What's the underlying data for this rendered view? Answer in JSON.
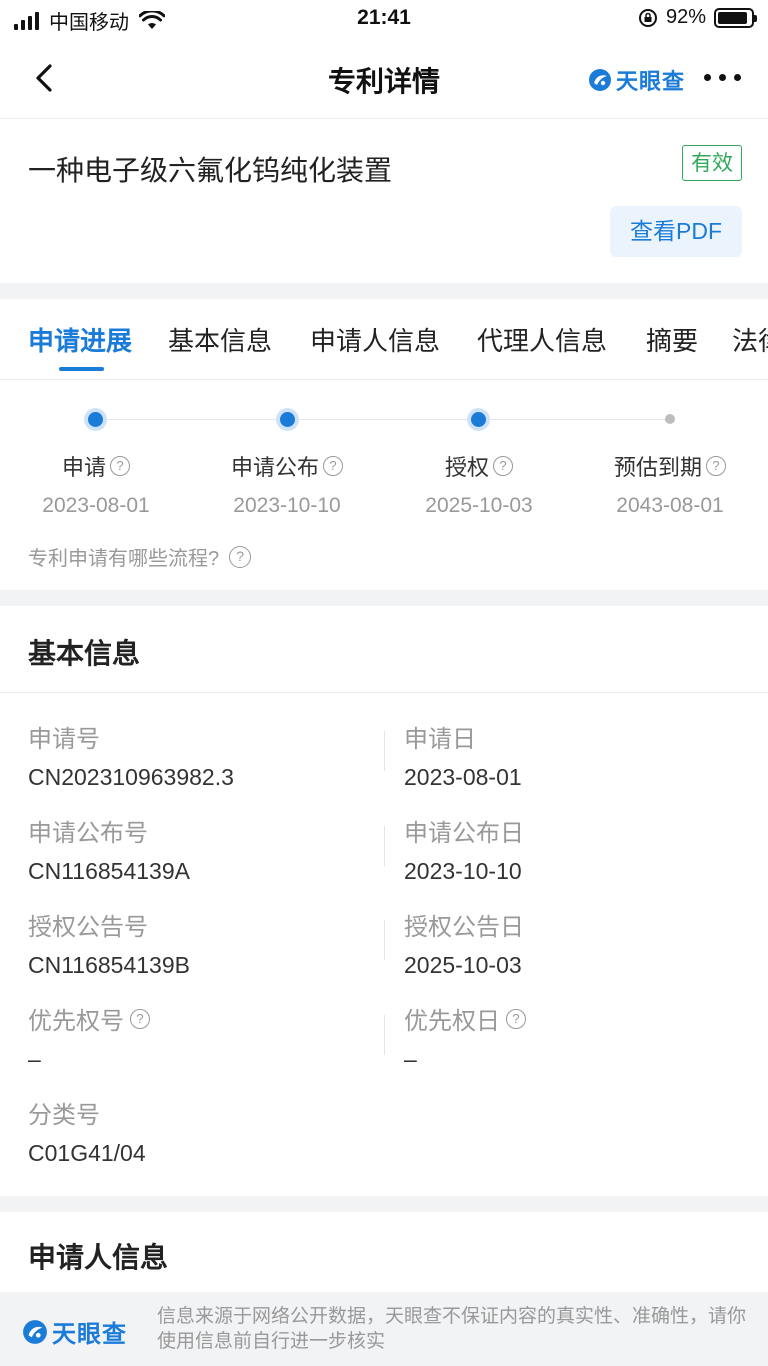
{
  "status_bar": {
    "carrier": "中国移动",
    "time": "21:41",
    "battery": "92%",
    "battery_level": 0.92
  },
  "nav": {
    "title": "专利详情",
    "brand": "天眼查"
  },
  "patent": {
    "title": "一种电子级六氟化钨纯化装置",
    "status": "有效",
    "pdf_button": "查看PDF"
  },
  "tabs": [
    "申请进展",
    "基本信息",
    "申请人信息",
    "代理人信息",
    "摘要",
    "法律"
  ],
  "progress": {
    "steps": [
      {
        "label": "申请",
        "date": "2023-08-01",
        "done": true
      },
      {
        "label": "申请公布",
        "date": "2023-10-10",
        "done": true
      },
      {
        "label": "授权",
        "date": "2025-10-03",
        "done": true
      },
      {
        "label": "预估到期",
        "date": "2043-08-01",
        "done": false
      }
    ],
    "faq": "专利申请有哪些流程?"
  },
  "basic_info": {
    "title": "基本信息",
    "fields": [
      {
        "label": "申请号",
        "value": "CN202310963982.3"
      },
      {
        "label": "申请日",
        "value": "2023-08-01"
      },
      {
        "label": "申请公布号",
        "value": "CN116854139A"
      },
      {
        "label": "申请公布日",
        "value": "2023-10-10"
      },
      {
        "label": "授权公告号",
        "value": "CN116854139B"
      },
      {
        "label": "授权公告日",
        "value": "2025-10-03"
      },
      {
        "label": "优先权号",
        "value": "–"
      },
      {
        "label": "优先权日",
        "value": "–"
      },
      {
        "label": "分类号",
        "value": "C01G41/04"
      }
    ]
  },
  "applicant_info": {
    "title": "申请人信息"
  },
  "footer": {
    "brand": "天眼查",
    "note": "信息来源于网络公开数据，天眼查不保证内容的真实性、准确性，请你使用信息前自行进一步核实"
  },
  "colors": {
    "accent": "#1a7bd8",
    "valid": "#2fa95a"
  }
}
